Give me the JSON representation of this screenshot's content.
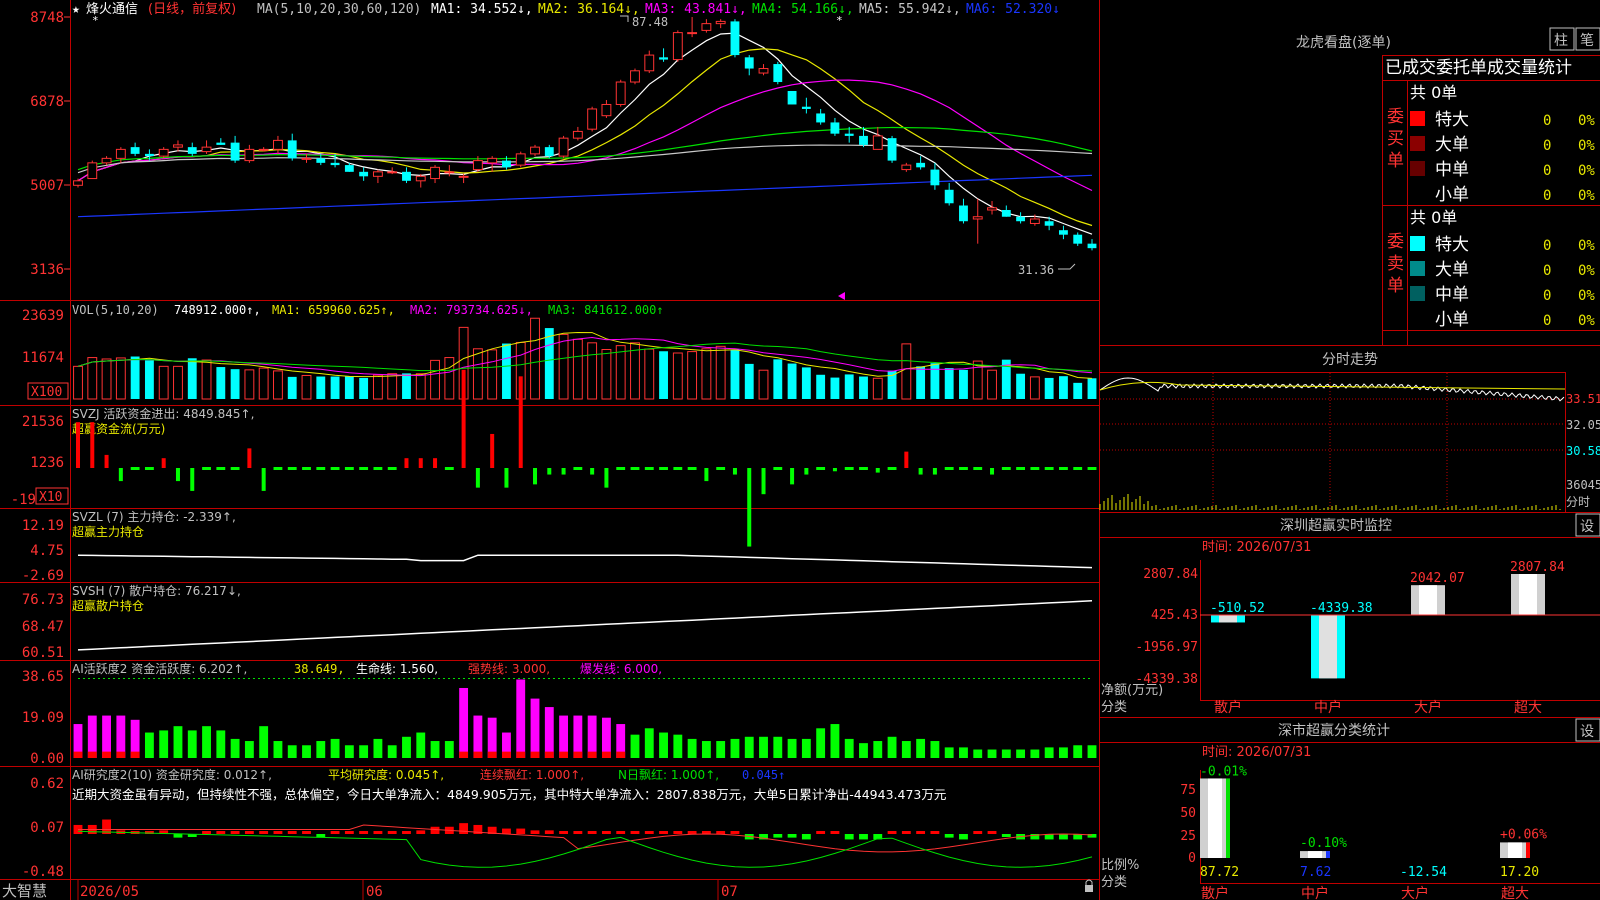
{
  "colors": {
    "up": "#ff3333",
    "down": "#00ffff",
    "frame": "#c00000",
    "ma1": "#ffffff",
    "ma2": "#e8e800",
    "ma3": "#ff00ff",
    "ma4": "#00e000",
    "ma5": "#c8c8c8",
    "ma6": "#1a36ff"
  },
  "header": {
    "star": "★",
    "stock_name": "烽火通信",
    "period": "(日线，前复权)",
    "ma_label": "MA(5,10,20,30,60,120)",
    "ma1": "MA1: 34.552↓,",
    "ma2": "MA2: 36.164↓,",
    "ma3": "MA3: 43.841↓,",
    "ma4": "MA4: 54.166↓,",
    "ma5": "MA5: 55.942↓,",
    "ma6": "MA6: 52.320↓"
  },
  "price_axis": [
    "8748",
    "6878",
    "5007",
    "3136"
  ],
  "price_annotations": {
    "high": "87.48",
    "low": "31.36"
  },
  "chart_data": [
    {
      "type": "candlestick",
      "name": "price",
      "ylim": [
        3136,
        8748
      ],
      "ohlc": [
        [
          5000,
          5150,
          4950,
          5100
        ],
        [
          5150,
          5550,
          5150,
          5500
        ],
        [
          5500,
          5650,
          5450,
          5600
        ],
        [
          5600,
          5850,
          5500,
          5800
        ],
        [
          5850,
          5950,
          5650,
          5700
        ],
        [
          5700,
          5800,
          5550,
          5650
        ],
        [
          5650,
          5850,
          5600,
          5800
        ],
        [
          5850,
          6000,
          5750,
          5900
        ],
        [
          5850,
          5950,
          5650,
          5700
        ],
        [
          5750,
          6000,
          5700,
          5850
        ],
        [
          5950,
          6050,
          5900,
          5900
        ],
        [
          5950,
          6100,
          5500,
          5550
        ],
        [
          5550,
          5900,
          5500,
          5800
        ],
        [
          5800,
          5850,
          5750,
          5800
        ],
        [
          5800,
          6100,
          5700,
          6000
        ],
        [
          6000,
          6150,
          5550,
          5600
        ],
        [
          5600,
          5700,
          5500,
          5600
        ],
        [
          5600,
          5700,
          5450,
          5500
        ],
        [
          5500,
          5700,
          5400,
          5450
        ],
        [
          5450,
          5500,
          5300,
          5300
        ],
        [
          5300,
          5400,
          5100,
          5200
        ],
        [
          5200,
          5350,
          5050,
          5300
        ],
        [
          5300,
          5400,
          5250,
          5300
        ],
        [
          5300,
          5400,
          5050,
          5100
        ],
        [
          5100,
          5250,
          4950,
          5200
        ],
        [
          5150,
          5450,
          5050,
          5400
        ],
        [
          5300,
          5450,
          5200,
          5300
        ],
        [
          5200,
          5250,
          5050,
          5200
        ],
        [
          5350,
          5650,
          5300,
          5550
        ],
        [
          5500,
          5650,
          5300,
          5600
        ],
        [
          5550,
          5650,
          5350,
          5400
        ],
        [
          5450,
          5750,
          5400,
          5700
        ],
        [
          5700,
          5900,
          5650,
          5850
        ],
        [
          5850,
          5900,
          5600,
          5650
        ],
        [
          5650,
          6100,
          5600,
          6050
        ],
        [
          6050,
          6300,
          6000,
          6200
        ],
        [
          6250,
          6750,
          6200,
          6700
        ],
        [
          6550,
          6900,
          6500,
          6800
        ],
        [
          6800,
          7350,
          6750,
          7300
        ],
        [
          7300,
          7600,
          7250,
          7550
        ],
        [
          7550,
          8000,
          7500,
          7900
        ],
        [
          7850,
          8050,
          7750,
          7800
        ],
        [
          7800,
          8450,
          7750,
          8400
        ],
        [
          8400,
          8748,
          8300,
          8400
        ],
        [
          8450,
          8700,
          8400,
          8600
        ],
        [
          8600,
          8700,
          8500,
          8650
        ],
        [
          8650,
          8700,
          7850,
          7900
        ],
        [
          7850,
          7900,
          7450,
          7600
        ],
        [
          7500,
          7700,
          7450,
          7600
        ],
        [
          7700,
          7750,
          7250,
          7300
        ],
        [
          7100,
          7100,
          6800,
          6800
        ],
        [
          6750,
          6950,
          6600,
          6700
        ],
        [
          6600,
          6700,
          6350,
          6400
        ],
        [
          6400,
          6500,
          6100,
          6150
        ],
        [
          6150,
          6300,
          5950,
          6100
        ],
        [
          6100,
          6300,
          5850,
          5900
        ],
        [
          5800,
          6300,
          5850,
          6100
        ],
        [
          6050,
          6100,
          5500,
          5550
        ],
        [
          5350,
          5500,
          5300,
          5450
        ],
        [
          5500,
          5650,
          5350,
          5400
        ],
        [
          5350,
          5500,
          4900,
          5000
        ],
        [
          4900,
          5050,
          4550,
          4600
        ],
        [
          4550,
          4700,
          4150,
          4200
        ],
        [
          4250,
          4700,
          3700,
          4300
        ],
        [
          4450,
          4650,
          4350,
          4500
        ],
        [
          4450,
          4550,
          4300,
          4300
        ],
        [
          4300,
          4400,
          4150,
          4200
        ],
        [
          4150,
          4350,
          4100,
          4250
        ],
        [
          4200,
          4300,
          4000,
          4100
        ],
        [
          4000,
          4100,
          3800,
          3900
        ],
        [
          3900,
          3950,
          3650,
          3700
        ],
        [
          3700,
          3800,
          3550,
          3600
        ]
      ]
    },
    {
      "type": "bar",
      "name": "VOL",
      "ylim": [
        0,
        23639
      ],
      "values": [
        9300,
        11800,
        11400,
        11700,
        12100,
        11000,
        9300,
        9300,
        11600,
        11100,
        9100,
        8500,
        8300,
        8800,
        8000,
        6300,
        6700,
        6400,
        6400,
        6400,
        6000,
        6800,
        7200,
        7300,
        7200,
        11000,
        11800,
        20400,
        14300,
        14000,
        15800,
        16100,
        23000,
        20200,
        18400,
        17000,
        16000,
        14100,
        15200,
        16000,
        14200,
        13600,
        13100,
        13500,
        14300,
        15000,
        14100,
        10000,
        8200,
        11300,
        10100,
        9000,
        6900,
        6100,
        7000,
        6400,
        5900,
        8100,
        15700,
        9300,
        10200,
        8800,
        8300,
        10800,
        8200,
        11200,
        7200,
        6300,
        6000,
        6500,
        4600,
        5900
      ]
    },
    {
      "type": "bar",
      "name": "SVZJ",
      "ylim": [
        -19,
        21536
      ],
      "values": [
        7000,
        7000,
        2000,
        -2000,
        0,
        0,
        1500,
        -2000,
        -3500,
        0,
        0,
        0,
        3000,
        -3500,
        0,
        0,
        0,
        0,
        0,
        0,
        0,
        0,
        0,
        1500,
        1500,
        1500,
        0,
        15000,
        -3000,
        5200,
        -3000,
        14000,
        -2500,
        -1000,
        -1000,
        0,
        -1000,
        -3000,
        0,
        0,
        0,
        0,
        0,
        0,
        -2000,
        0,
        -1000,
        -12000,
        -4000,
        0,
        -2500,
        -1000,
        0,
        -500,
        0,
        0,
        -700,
        0,
        2500,
        -1000,
        -1000,
        0,
        0,
        0,
        -1000,
        0,
        0,
        0,
        0,
        0,
        0,
        0
      ]
    },
    {
      "type": "line",
      "name": "SVZL",
      "ylim": [
        -2.69,
        12.19
      ]
    },
    {
      "type": "line",
      "name": "SVSH",
      "ylim": [
        60.51,
        76.73
      ]
    },
    {
      "type": "bar",
      "name": "AI活跃度2",
      "ylim": [
        0,
        38.65
      ],
      "values": [
        16,
        20,
        20,
        20,
        18,
        12,
        13,
        15,
        13,
        15,
        13,
        9,
        8,
        15,
        8,
        6,
        6,
        8,
        9,
        6,
        6,
        9,
        6,
        10,
        12,
        8,
        8,
        33,
        20,
        19,
        12,
        37,
        28,
        24,
        20,
        20,
        20,
        19,
        16,
        11,
        14,
        12,
        11,
        9,
        8,
        8,
        9,
        10,
        10,
        10,
        9,
        9,
        14,
        16,
        9,
        7,
        8,
        10,
        8,
        9,
        8,
        5,
        5,
        4,
        4,
        4,
        4,
        4,
        5,
        5,
        6,
        6
      ]
    },
    {
      "type": "bar",
      "name": "AI研究度2",
      "ylim": [
        -0.48,
        0.62
      ],
      "values": [
        0.05,
        0.05,
        0.08,
        0.02,
        0,
        0.01,
        0.02,
        -0.02,
        -0.01,
        0,
        0,
        0,
        0,
        0.01,
        0,
        0,
        0,
        -0.02,
        0,
        0,
        0,
        0,
        0,
        0,
        0.02,
        0.04,
        0.04,
        0.06,
        0.05,
        0.04,
        0.03,
        0.03,
        0.02,
        0.02,
        0.01,
        0,
        0,
        0,
        0,
        0,
        0,
        0,
        0,
        0,
        0,
        0,
        0,
        -0.03,
        -0.03,
        -0.02,
        -0.02,
        -0.03,
        0,
        0,
        -0.03,
        -0.03,
        -0.03,
        0,
        0,
        0,
        0,
        -0.02,
        -0.03,
        0,
        0,
        -0.01,
        -0.03,
        -0.03,
        -0.03,
        -0.03,
        -0.03,
        -0.02
      ]
    }
  ],
  "vol_panel": {
    "label": "VOL(5,10,20)",
    "v": "748912.000↑,",
    "ma1": "MA1: 659960.625↑,",
    "ma2": "MA2: 793734.625↓,",
    "ma3": "MA3: 841612.000↑",
    "axis": [
      "23639",
      "11674"
    ],
    "unit": "X100"
  },
  "svzj_panel": {
    "label": "SVZJ  活跃资金进出: 4849.845↑,",
    "sub": "超赢资金流(万元)",
    "axis": [
      "21536",
      "1236",
      "-19"
    ],
    "unit": "X10"
  },
  "svzl_panel": {
    "label": "SVZL  (7) 主力持仓: -2.339↑,",
    "sub": "超赢主力持仓",
    "axis": [
      "12.19",
      "4.75",
      "-2.69"
    ]
  },
  "svsh_panel": {
    "label": "SVSH  (7) 散户持仓: 76.217↓,",
    "sub": "超赢散户持仓",
    "axis": [
      "76.73",
      "68.47",
      "60.51"
    ]
  },
  "ai_panel": {
    "label": "AI活跃度2 资金活跃度: 6.202↑,",
    "v2": "38.649,",
    "v3": "生命线: 1.560,",
    "v4": "强势线: 3.000,",
    "v5": "爆发线: 6.000,",
    "axis": [
      "38.65",
      "19.09",
      "0.00"
    ]
  },
  "ai2_panel": {
    "label": "AI研究度2(10) 资金研究度: 0.012↑,",
    "v2": "平均研究度: 0.045↑,",
    "v3": "连续飘红: 1.000↑,",
    "v4": "N日飘红: 1.000↑,",
    "v5": "0.045↑",
    "comment": "近期大资金虽有异动，但持续性不强，总体偏空，今日大单净流入：4849.905万元，其中特大单净流入：2807.838万元，大单5日累计净出-44943.473万元",
    "axis": [
      "0.62",
      "0.07",
      "-0.48"
    ]
  },
  "dates": {
    "brand": "大智慧",
    "d1": "2026/05",
    "d2": "06",
    "d3": "07"
  },
  "right_panel": {
    "title": "龙虎看盘(逐单)",
    "btn1": "柱",
    "btn2": "笔",
    "subtitle": "已成交委托单成交量统计",
    "buy": {
      "label": "委买单",
      "total": "共 0单",
      "rows": [
        {
          "name": "特大",
          "v": "0",
          "p": "0%"
        },
        {
          "name": "大单",
          "v": "0",
          "p": "0%"
        },
        {
          "name": "中单",
          "v": "0",
          "p": "0%"
        },
        {
          "name": "小单",
          "v": "0",
          "p": "0%"
        }
      ]
    },
    "sell": {
      "label": "委卖单",
      "total": "共 0单",
      "rows": [
        {
          "name": "特大",
          "v": "0",
          "p": "0%"
        },
        {
          "name": "大单",
          "v": "0",
          "p": "0%"
        },
        {
          "name": "中单",
          "v": "0",
          "p": "0%"
        },
        {
          "name": "小单",
          "v": "0",
          "p": "0%"
        }
      ]
    },
    "intraday_title": "分时走势",
    "intraday_axis": [
      "33.51",
      "32.05",
      "30.58",
      "36045"
    ],
    "intraday_unit": "分时",
    "sz_title": "深圳超赢实时监控",
    "sz_btn": "设",
    "sz_time": "时间: 2026/07/31",
    "sz_axis": [
      "2807.84",
      "425.43",
      "-1956.97",
      "-4339.38"
    ],
    "sz_values": [
      {
        "name": "散户",
        "v": -510.52,
        "label": "-510.52"
      },
      {
        "name": "中户",
        "v": -4339.38,
        "label": "-4339.38"
      },
      {
        "name": "大户",
        "v": 2042.07,
        "label": "2042.07"
      },
      {
        "name": "超大",
        "v": 2807.84,
        "label": "2807.84"
      }
    ],
    "sz_y1": "净额(万元)",
    "sz_y2": "分类",
    "szc_title": "深市超赢分类统计",
    "szc_btn": "设",
    "szc_time": "时间: 2026/07/31",
    "szc_axis": [
      "75",
      "50",
      "25",
      "0"
    ],
    "szc_values": [
      {
        "name": "散户",
        "pct": 87.72,
        "top": "-0.01%",
        "bottom": "87.72"
      },
      {
        "name": "中户",
        "pct": 7.62,
        "top": "-0.10%",
        "bottom": "7.62"
      },
      {
        "name": "大户",
        "pct": 0,
        "top": "",
        "bottom": "-12.54"
      },
      {
        "name": "超大",
        "pct": 17.2,
        "top": "+0.06%",
        "bottom": "17.20"
      }
    ],
    "szc_y1": "比例%",
    "szc_y2": "分类"
  }
}
